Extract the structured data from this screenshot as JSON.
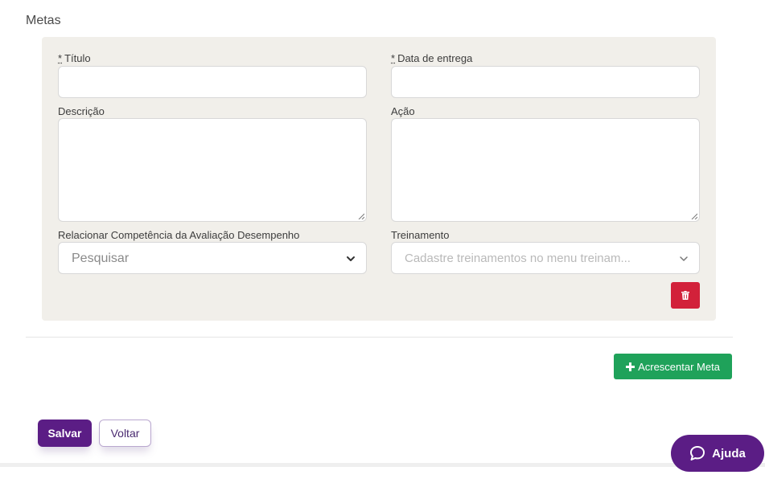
{
  "section": {
    "title": "Metas"
  },
  "form": {
    "required_marker": "*",
    "titulo_label": "Título",
    "titulo_value": "",
    "data_label": "Data de entrega",
    "data_value": "",
    "descricao_label": "Descrição",
    "descricao_value": "",
    "acao_label": "Ação",
    "acao_value": "",
    "competencia_label": "Relacionar Competência da Avaliação Desempenho",
    "competencia_placeholder": "Pesquisar",
    "treinamento_label": "Treinamento",
    "treinamento_placeholder": "Cadastre treinamentos no menu treinam..."
  },
  "actions": {
    "add_meta_label": "Acrescentar Meta",
    "save_label": "Salvar",
    "back_label": "Voltar",
    "help_label": "Ajuda"
  },
  "icons": {
    "delete": "trash-icon",
    "add": "plus-icon",
    "help": "chat-bubble-icon",
    "select": "chevron-down-icon"
  },
  "colors": {
    "primary": "#5b1d85",
    "success": "#1fa25a",
    "danger": "#d2213a",
    "panel_bg": "#f1efea"
  }
}
